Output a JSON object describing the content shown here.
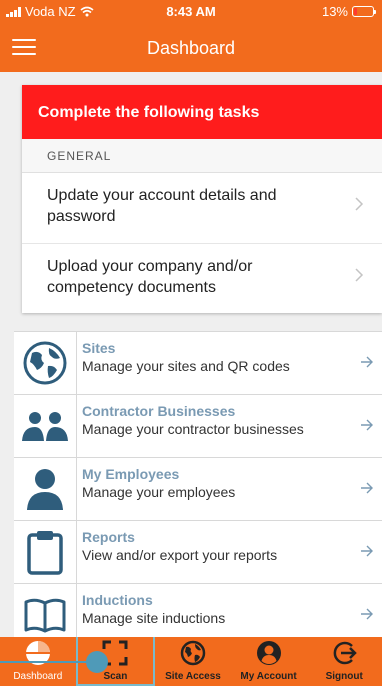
{
  "status_bar": {
    "carrier": "Voda NZ",
    "time": "8:43 AM",
    "battery": "13%"
  },
  "header": {
    "title": "Dashboard",
    "menu_icon": "hamburger-icon"
  },
  "tasks": {
    "title": "Complete the following tasks",
    "section": "GENERAL",
    "items": [
      {
        "label": "Update your account details and password"
      },
      {
        "label": "Upload your company and/or competency documents"
      }
    ]
  },
  "menu": [
    {
      "title": "Sites",
      "subtitle": "Manage your sites and QR codes",
      "icon": "globe-icon"
    },
    {
      "title": "Contractor Businesses",
      "subtitle": "Manage your contractor businesses",
      "icon": "people-icon"
    },
    {
      "title": "My Employees",
      "subtitle": "Manage your employees",
      "icon": "person-icon"
    },
    {
      "title": "Reports",
      "subtitle": "View and/or export your reports",
      "icon": "clipboard-icon"
    },
    {
      "title": "Inductions",
      "subtitle": "Manage site inductions",
      "icon": "book-icon"
    }
  ],
  "tabs": [
    {
      "label": "Dashboard",
      "icon": "pie-chart-icon",
      "active": true
    },
    {
      "label": "Scan",
      "icon": "scan-icon"
    },
    {
      "label": "Site Access",
      "icon": "globe-icon"
    },
    {
      "label": "My Account",
      "icon": "user-circle-icon"
    },
    {
      "label": "Signout",
      "icon": "signout-icon"
    }
  ],
  "colors": {
    "brand": "#f26b1d",
    "alert": "#ff1c1c",
    "link_title": "#7a9ab3",
    "icon_blue": "#2f5d7c"
  }
}
